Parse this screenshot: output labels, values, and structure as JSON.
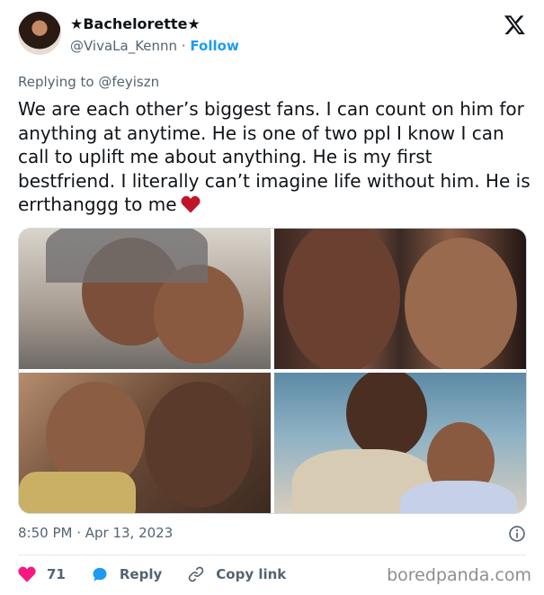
{
  "author": {
    "display_name": "★Bachelorette★",
    "handle": "@VivaLa_Kennn",
    "separator": "·",
    "follow_label": "Follow"
  },
  "replying_to": "Replying to @feyiszn",
  "tweet": {
    "text": "We are each other’s biggest fans. I can count on him for anything at anytime. He is one of two ppl I know I can call to uplift me about anything. He is my first bestfriend. I literally can’t imagine life without him. He is errthanggg to me",
    "emoji": "heart-emoji",
    "timestamp": "8:50 PM · Apr 13, 2023"
  },
  "photos": [
    "photo-1",
    "photo-2",
    "photo-3",
    "photo-4"
  ],
  "actions": {
    "like_count": "71",
    "reply_label": "Reply",
    "copy_link_label": "Copy link"
  },
  "watermark": "boredpanda.com",
  "colors": {
    "accent": "#1d9bf0",
    "like": "#f91880",
    "reply_icon": "#1d9bf0",
    "secondary_text": "#536471",
    "heart_emoji": "#c0142a"
  }
}
